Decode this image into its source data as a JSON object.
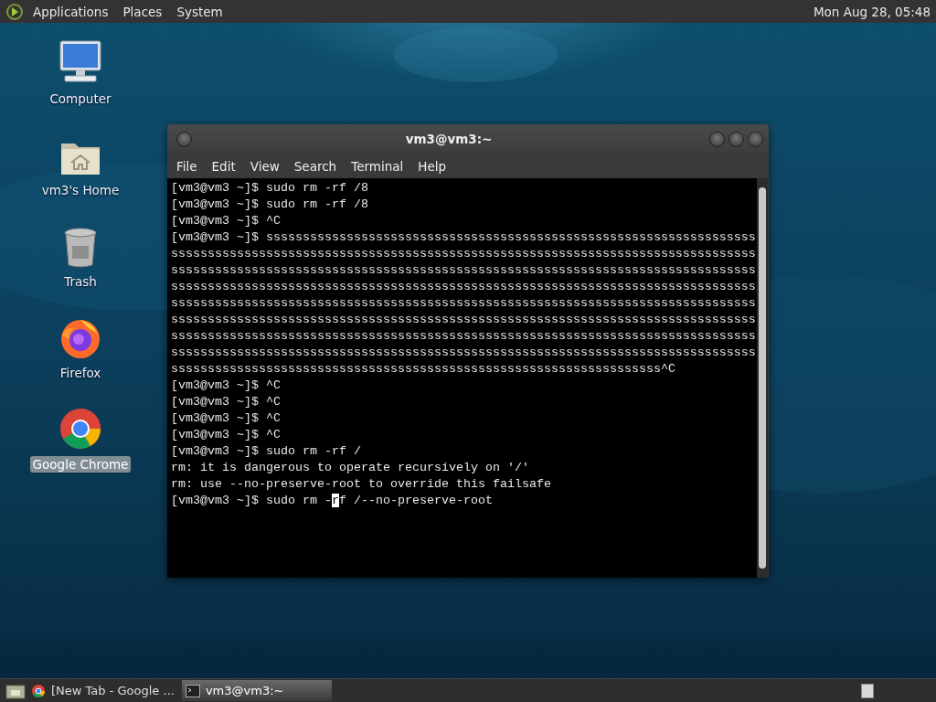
{
  "top_panel": {
    "menus": [
      "Applications",
      "Places",
      "System"
    ],
    "clock": "Mon Aug 28, 05:48"
  },
  "desktop_icons": [
    {
      "label": "Computer",
      "kind": "computer",
      "selected": false
    },
    {
      "label": "vm3's Home",
      "kind": "home",
      "selected": false
    },
    {
      "label": "Trash",
      "kind": "trash",
      "selected": false
    },
    {
      "label": "Firefox",
      "kind": "firefox",
      "selected": false
    },
    {
      "label": "Google Chrome",
      "kind": "chrome",
      "selected": true
    }
  ],
  "terminal": {
    "title": "vm3@vm3:~",
    "menu": [
      "File",
      "Edit",
      "View",
      "Search",
      "Terminal",
      "Help"
    ],
    "lines": [
      "[vm3@vm3 ~]$ sudo rm -rf /8",
      "[vm3@vm3 ~]$ sudo rm -rf /8",
      "[vm3@vm3 ~]$ ^C",
      "[vm3@vm3 ~]$ sssssssssssssssssssssssssssssssssssssssssssssssssssssssssssssssssss",
      "ssssssssssssssssssssssssssssssssssssssssssssssssssssssssssssssssssssssssssssssss",
      "ssssssssssssssssssssssssssssssssssssssssssssssssssssssssssssssssssssssssssssssss",
      "ssssssssssssssssssssssssssssssssssssssssssssssssssssssssssssssssssssssssssssssss",
      "ssssssssssssssssssssssssssssssssssssssssssssssssssssssssssssssssssssssssssssssss",
      "ssssssssssssssssssssssssssssssssssssssssssssssssssssssssssssssssssssssssssssssss",
      "ssssssssssssssssssssssssssssssssssssssssssssssssssssssssssssssssssssssssssssssss",
      "ssssssssssssssssssssssssssssssssssssssssssssssssssssssssssssssssssssssssssssssss",
      "sssssssssssssssssssssssssssssssssssssssssssssssssssssssssssssssssss^C",
      "[vm3@vm3 ~]$ ^C",
      "[vm3@vm3 ~]$ ^C",
      "[vm3@vm3 ~]$ ^C",
      "[vm3@vm3 ~]$ ^C",
      "[vm3@vm3 ~]$ sudo rm -rf /",
      "rm: it is dangerous to operate recursively on '/'",
      "rm: use --no-preserve-root to override this failsafe"
    ],
    "input_line": {
      "before": "[vm3@vm3 ~]$ sudo rm -",
      "cursor": "r",
      "after": "f /--no-preserve-root"
    }
  },
  "taskbar": {
    "tasks": [
      {
        "label": "[New Tab - Google ...",
        "kind": "browser",
        "selected": false
      },
      {
        "label": "vm3@vm3:~",
        "kind": "terminal",
        "selected": true
      }
    ]
  }
}
